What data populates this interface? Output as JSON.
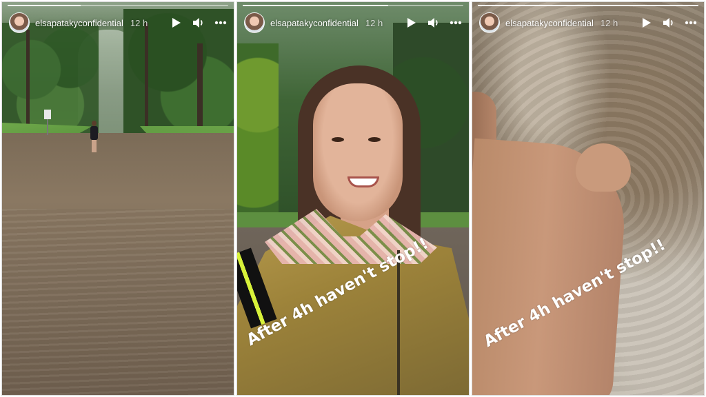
{
  "stories": [
    {
      "username": "elsapatakyconfidential",
      "time": "12 h",
      "progress_fraction": 0.33,
      "caption": ""
    },
    {
      "username": "elsapatakyconfidential",
      "time": "12 h",
      "progress_fraction": 0.66,
      "caption": "After 4h haven't stop!!"
    },
    {
      "username": "elsapatakyconfidential",
      "time": "12 h",
      "progress_fraction": 1.0,
      "caption": "After 4h haven't stop!!"
    }
  ],
  "icons": {
    "play": "play-icon",
    "volume": "volume-icon",
    "more": "more-options-icon"
  }
}
